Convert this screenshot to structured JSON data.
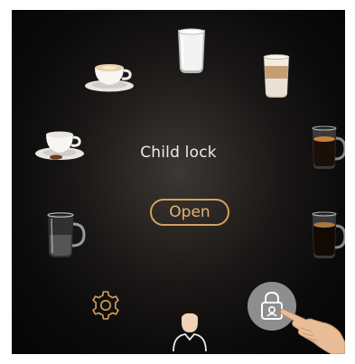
{
  "screen": {
    "title": "Child lock",
    "open_label": "Open"
  },
  "beverages": [
    {
      "name": "latte-glass-icon"
    },
    {
      "name": "latte-macchiato-icon"
    },
    {
      "name": "espresso-glass-icon"
    },
    {
      "name": "coffee-glass-icon"
    },
    {
      "name": "hot-water-glass-icon"
    },
    {
      "name": "cappuccino-cup-icon"
    },
    {
      "name": "espresso-cup-icon"
    }
  ],
  "controls": [
    {
      "name": "settings-gear-icon"
    },
    {
      "name": "user-profile-icon"
    },
    {
      "name": "lock-icon"
    }
  ],
  "colors": {
    "accent": "#d6a25a",
    "text": "#ececec",
    "background": "#0c0b0b",
    "lock_circle": "#8e8e8e"
  }
}
